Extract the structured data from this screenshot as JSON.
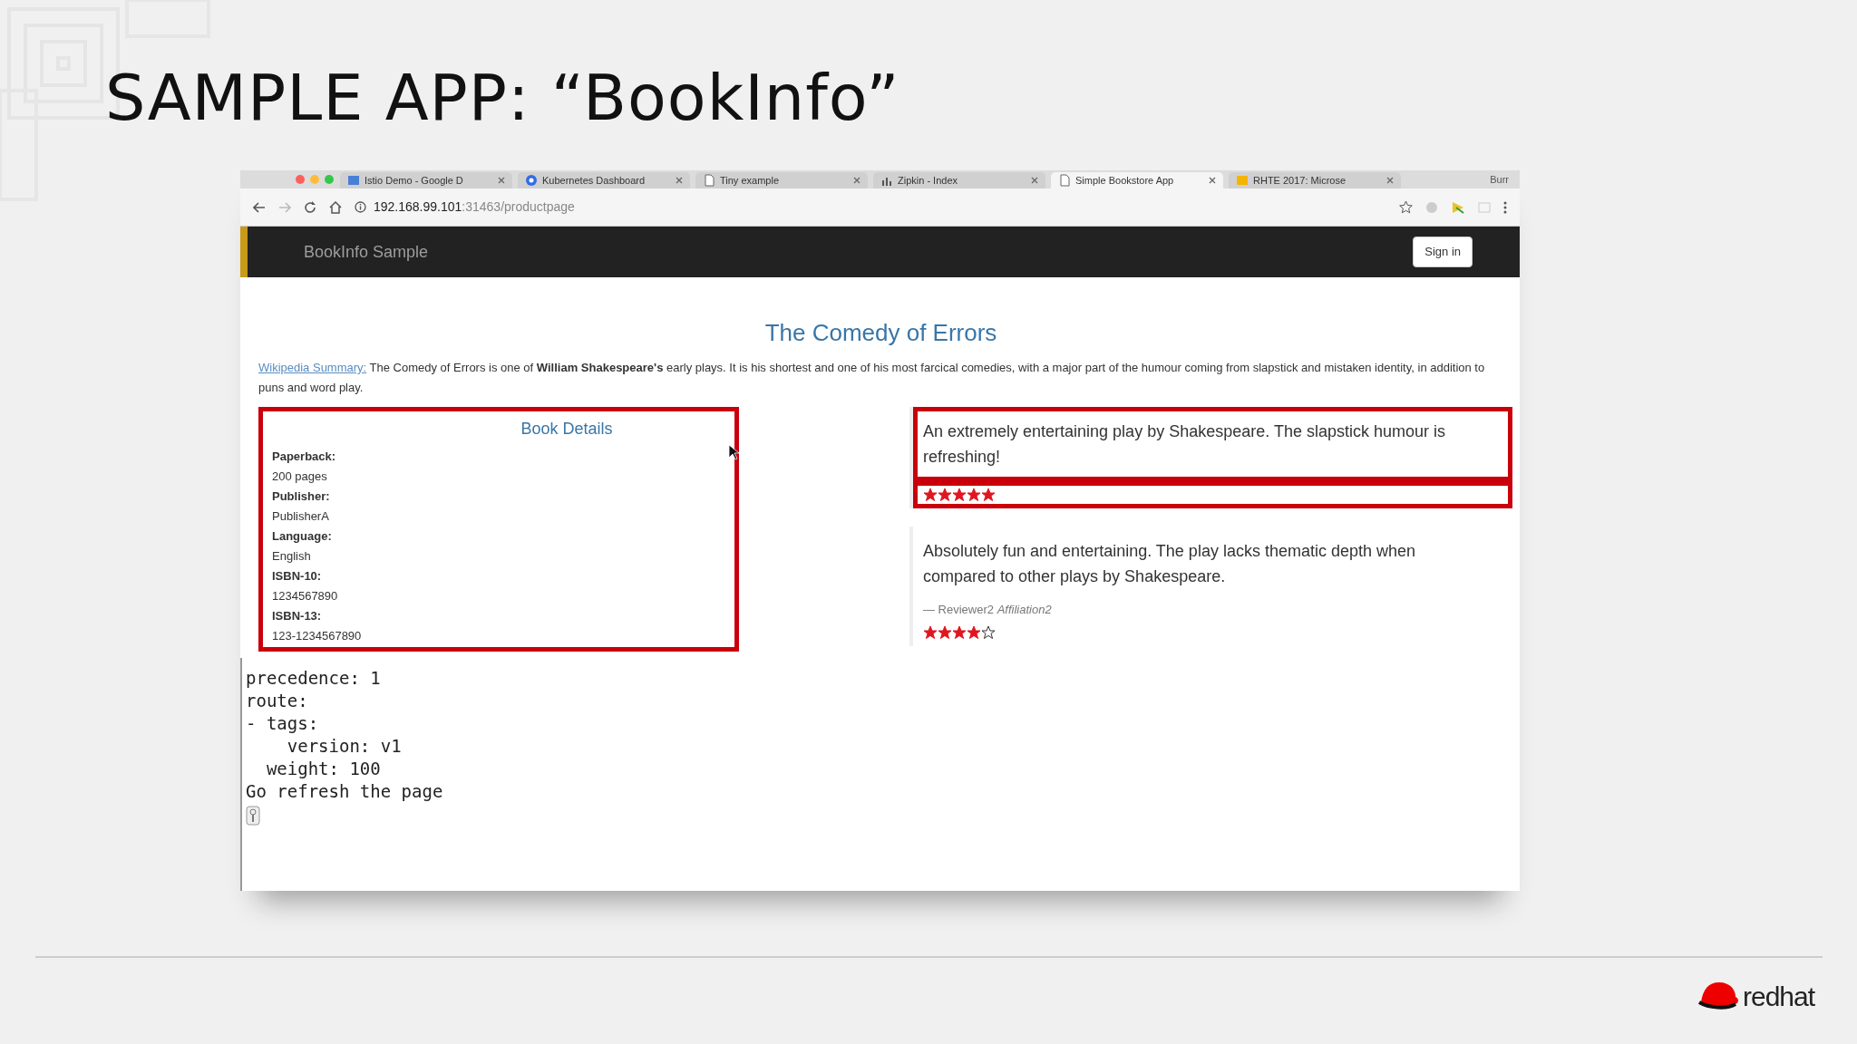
{
  "slide": {
    "title": "SAMPLE APP: “BookInfo”"
  },
  "browser": {
    "tabs": [
      {
        "label": "Istio Demo - Google D",
        "selected": false
      },
      {
        "label": "Kubernetes Dashboard",
        "selected": false
      },
      {
        "label": "Tiny example",
        "selected": false
      },
      {
        "label": "Zipkin - Index",
        "selected": false
      },
      {
        "label": "Simple Bookstore App",
        "selected": true
      },
      {
        "label": "RHTE 2017: Microse",
        "selected": false
      }
    ],
    "profile": "Burr",
    "address": {
      "host": "192.168.99.101",
      "rest": ":31463/productpage"
    }
  },
  "app": {
    "brand": "BookInfo Sample",
    "sign_in": "Sign in",
    "title": "The Comedy of Errors",
    "summary_link": "Wikipedia Summary:",
    "summary": "The Comedy of Errors is one of **William Shakespeare's** early plays. It is his shortest and one of his most farcical comedies, with a major part of the humour coming from slapstick and mistaken identity, in addition to puns and word play.",
    "details": {
      "heading": "Book Details",
      "highlighted": true,
      "fields": [
        {
          "label": "Paperback:",
          "value": "200 pages"
        },
        {
          "label": "Publisher:",
          "value": "PublisherA"
        },
        {
          "label": "Language:",
          "value": "English"
        },
        {
          "label": "ISBN-10:",
          "value": "1234567890"
        },
        {
          "label": "ISBN-13:",
          "value": "123-1234567890"
        }
      ]
    },
    "reviews": [
      {
        "text": "An extremely entertaining play by Shakespeare. The slapstick humour is refreshing!",
        "stars": 5,
        "highlighted": true
      },
      {
        "text": "Absolutely fun and entertaining. The play lacks thematic depth when compared to other plays by Shakespeare.",
        "reviewer": "— Reviewer2",
        "affiliation": "Affiliation2",
        "stars": 4,
        "highlighted": false
      }
    ]
  },
  "terminal": {
    "lines": [
      "precedence: 1",
      "route:",
      "- tags:",
      "    version: v1",
      "  weight: 100",
      "Go refresh the page"
    ]
  },
  "footer": {
    "logo": "redhat"
  }
}
